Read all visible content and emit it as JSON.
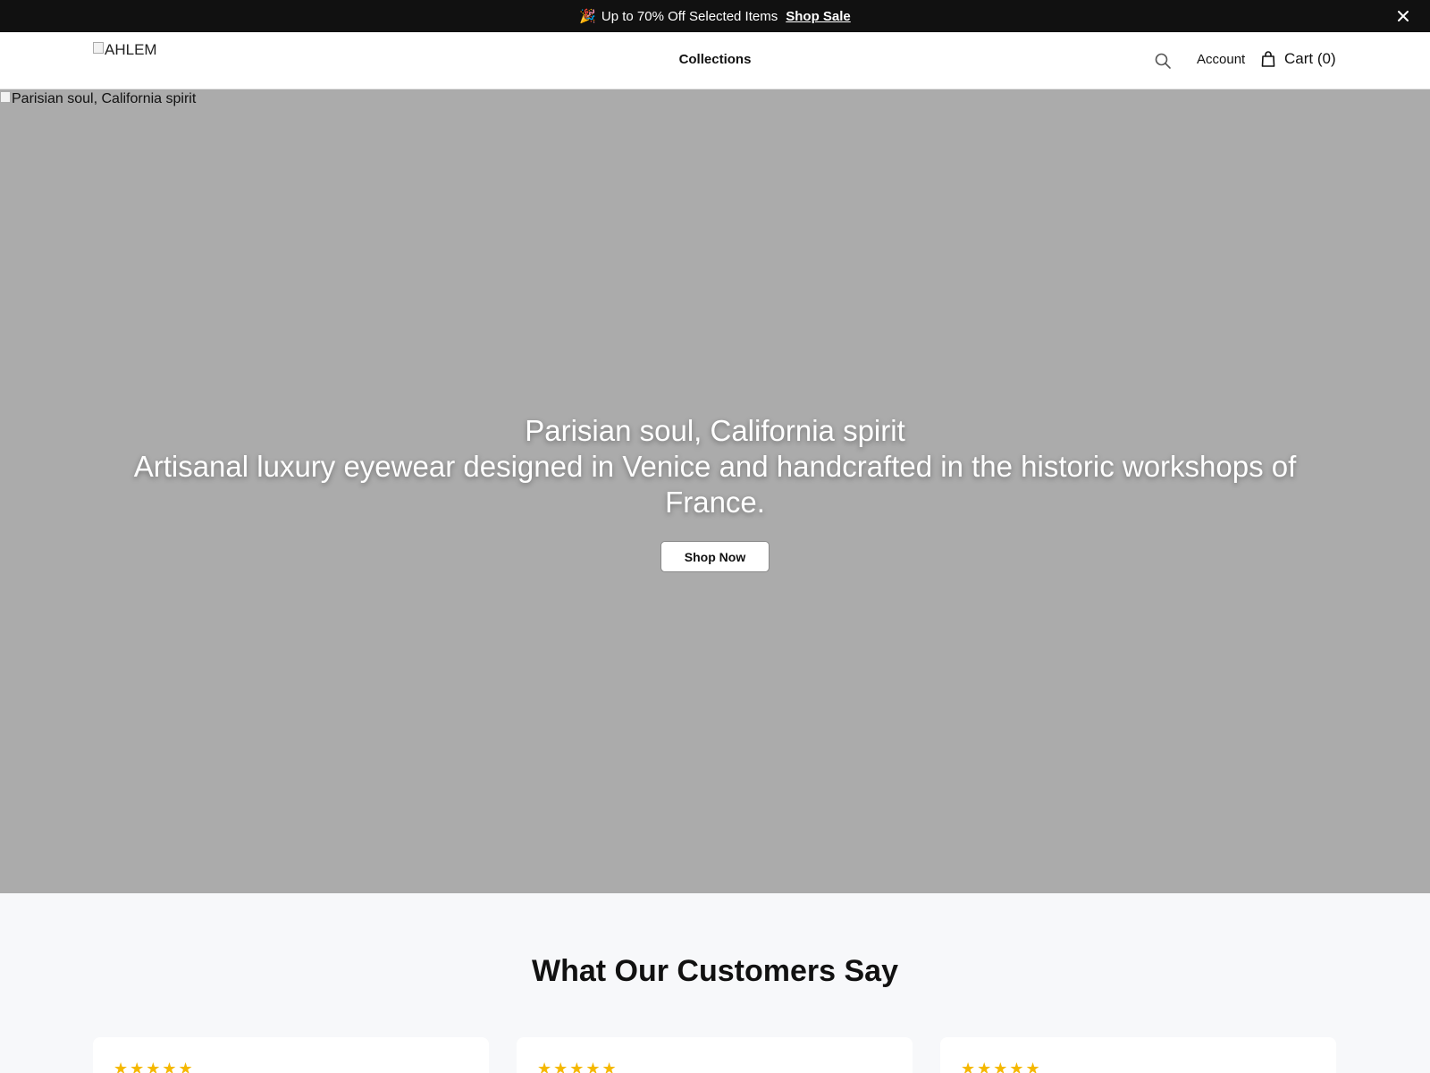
{
  "announcement": {
    "emoji": "🎉",
    "text": "Up to 70% Off Selected Items",
    "link_label": "Shop Sale"
  },
  "header": {
    "logo_alt": "AHLEM",
    "nav": [
      "Collections"
    ],
    "account_label": "Account",
    "cart_label": "Cart (0)"
  },
  "hero": {
    "image_alt": "Parisian soul, California spirit",
    "title": "Parisian soul, California spirit",
    "subtitle": "Artisanal luxury eyewear designed in Venice and handcrafted in the historic workshops of France.",
    "cta_label": "Shop Now",
    "background_color": "#ababab"
  },
  "testimonials": {
    "heading": "What Our Customers Say",
    "cards": [
      {
        "stars": "★★★★★"
      },
      {
        "stars": "★★★★★"
      },
      {
        "stars": "★★★★★"
      }
    ],
    "star_color": "#f5b800"
  },
  "colors": {
    "announcement_bg": "#111111",
    "testimonials_bg": "#f7f8fa"
  },
  "icons": [
    "close-icon",
    "search-icon",
    "bag-icon",
    "broken-image-icon",
    "star-icon"
  ]
}
